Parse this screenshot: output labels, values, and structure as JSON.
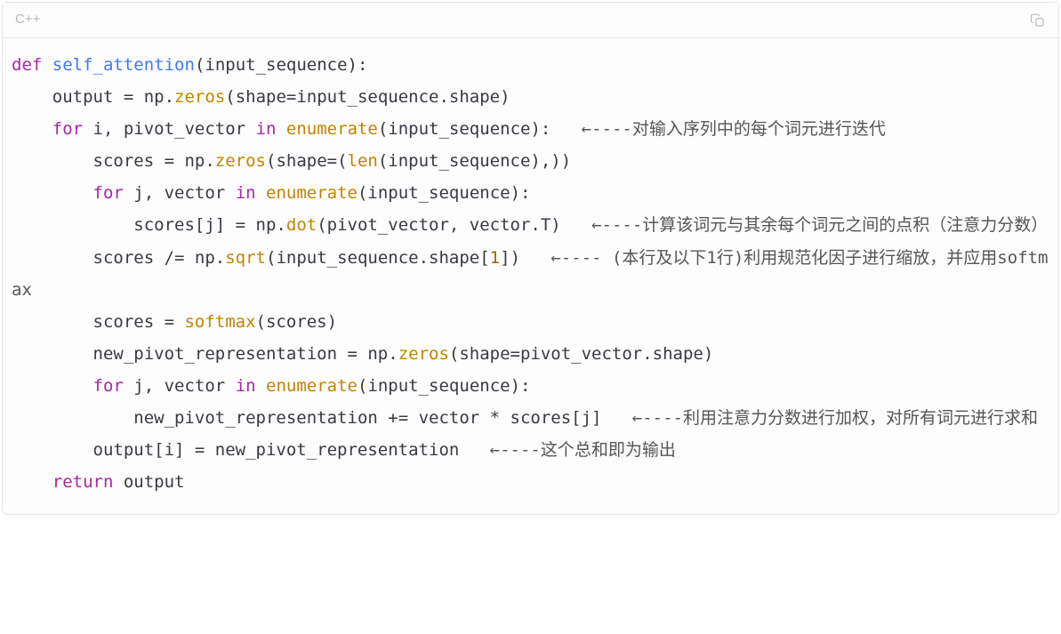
{
  "header": {
    "language_label": "C++",
    "copy_icon_name": "copy-icon"
  },
  "code": {
    "l1": {
      "kw1": "def",
      "fn": "self_attention",
      "rest": "(input_sequence):"
    },
    "l2": {
      "pre": "    output = np.",
      "call": "zeros",
      "post": "(shape=input_sequence.shape)"
    },
    "l3": {
      "kw1": "    for",
      "mid": " i, pivot_vector ",
      "kw2": "in",
      "sp": " ",
      "call": "enumerate",
      "post": "(input_sequence):   ",
      "comment": "←----对输入序列中的每个词元进行迭代"
    },
    "l4": {
      "pre": "        scores = np.",
      "call1": "zeros",
      "mid": "(shape=(",
      "call2": "len",
      "post": "(input_sequence),))"
    },
    "l5": {
      "kw1": "        for",
      "mid": " j, vector ",
      "kw2": "in",
      "sp": " ",
      "call": "enumerate",
      "post": "(input_sequence):"
    },
    "l6": {
      "pre": "            scores[j] = np.",
      "call": "dot",
      "post": "(pivot_vector, vector.T)   ",
      "comment": "←----计算该词元与其余每个词元之间的点积（注意力分数）"
    },
    "l7": {
      "pre": "        scores /= np.",
      "call": "sqrt",
      "mid": "(input_sequence.shape[",
      "num": "1",
      "post": "])   ",
      "comment": "←---- (本行及以下1行)利用规范化因子进行缩放，并应用softmax"
    },
    "l8": {
      "pre": "        scores = ",
      "call": "softmax",
      "post": "(scores)"
    },
    "l9": {
      "pre": "        new_pivot_representation = np.",
      "call": "zeros",
      "post": "(shape=pivot_vector.shape)"
    },
    "l10": {
      "kw1": "        for",
      "mid": " j, vector ",
      "kw2": "in",
      "sp": " ",
      "call": "enumerate",
      "post": "(input_sequence):"
    },
    "l11": {
      "pre": "            new_pivot_representation += vector * scores[j]   ",
      "comment": "←----利用注意力分数进行加权，对所有词元进行求和"
    },
    "l12": {
      "pre": "        output[i] = new_pivot_representation   ",
      "comment": "←----这个总和即为输出"
    },
    "l13": {
      "kw": "    return",
      "post": " output"
    }
  }
}
